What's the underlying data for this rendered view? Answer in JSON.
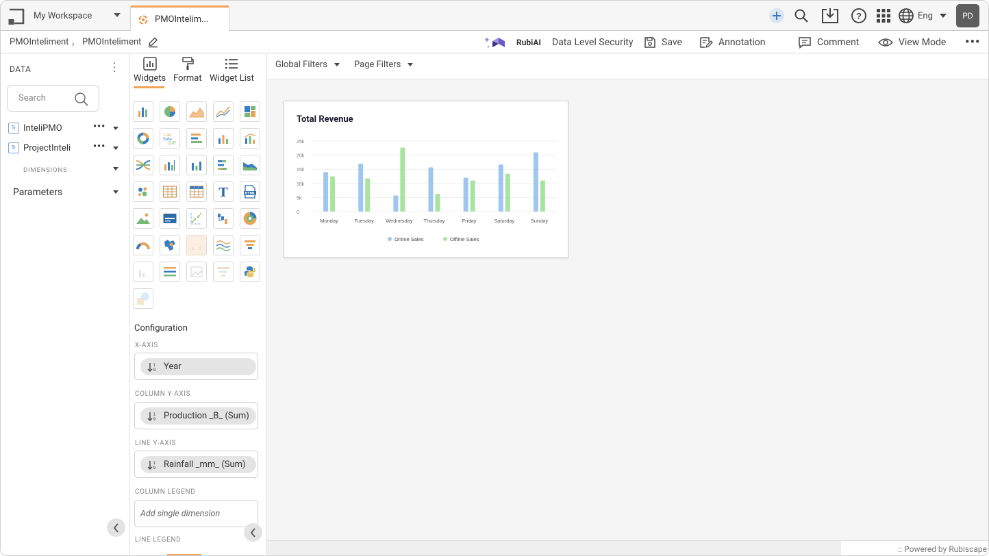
{
  "topbar": {
    "workspace": "My Workspace",
    "tab_label": "PMOIntelim...",
    "language": "Eng",
    "avatar": "PD"
  },
  "breadcrumb": {
    "first": "PMOInteliment",
    "second": "PMOInteliment"
  },
  "actions": {
    "rubi": "RubiAI",
    "security": "Data Level Security",
    "save": "Save",
    "annotation": "Annotation",
    "comment": "Comment",
    "view_mode": "View Mode"
  },
  "data_panel": {
    "title": "DATA",
    "search_placeholder": "Search",
    "datasets": [
      "InteliPMO",
      "ProjectInteli"
    ],
    "dimensions": "DIMENSIONS",
    "parameters": "Parameters"
  },
  "widget_panel": {
    "tabs": [
      "Widgets",
      "Format",
      "Widget List"
    ],
    "configuration": "Configuration",
    "x_axis_label": "X-AXIS",
    "x_axis_value": "Year",
    "column_y_label": "COLUMN Y-AXIS",
    "column_y_value": "Production _B_ (Sum)",
    "line_y_label": "LINE Y-AXIS",
    "line_y_value": "Rainfall _mm_ (Sum)",
    "column_legend_label": "COLUMN LEGEND",
    "column_legend_placeholder": "Add single dimension",
    "line_legend_label": "LINE LEGEND"
  },
  "filters": {
    "global": "Global Filters",
    "page": "Page Filters"
  },
  "footer": ":: Powered by Rubiscape",
  "colors": {
    "accent": "#f0a25a",
    "online": "#9fc6ef",
    "offline": "#a8e3a0"
  },
  "chart_data": {
    "type": "bar",
    "title": "Total Revenue",
    "categories": [
      "Monday",
      "Tuesday",
      "Wednesday",
      "Thursday",
      "Friday",
      "Saturday",
      "Sunday"
    ],
    "yticks": [
      "0",
      "5k",
      "10k",
      "15k",
      "20k",
      "25k"
    ],
    "ylim": [
      0,
      25000
    ],
    "series": [
      {
        "name": "Online Sales",
        "color": "#9fc6ef",
        "values": [
          14000,
          17000,
          5700,
          15700,
          12000,
          16700,
          21000
        ]
      },
      {
        "name": "Offline Sales",
        "color": "#a8e3a0",
        "values": [
          12500,
          11800,
          22700,
          6300,
          11000,
          13400,
          11000
        ]
      }
    ],
    "legend": "bottom"
  }
}
